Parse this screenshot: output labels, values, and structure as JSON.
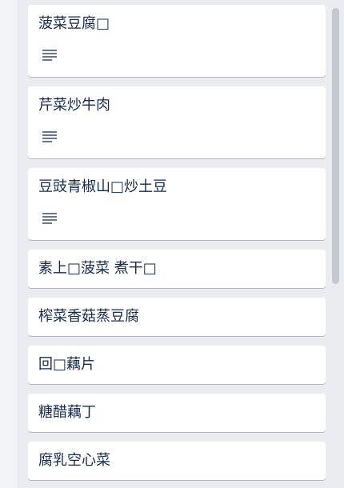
{
  "board": {
    "cards": [
      {
        "title": "菠菜豆腐□",
        "has_description": true
      },
      {
        "title": "芹菜炒牛肉",
        "has_description": true
      },
      {
        "title": "豆豉青椒山□炒土豆",
        "has_description": true
      },
      {
        "title": "素上□菠菜 煮干□",
        "has_description": false
      },
      {
        "title": "榨菜香菇蒸豆腐",
        "has_description": false
      },
      {
        "title": "回□藕片",
        "has_description": false
      },
      {
        "title": "糖醋藕丁",
        "has_description": false
      },
      {
        "title": "腐乳空心菜",
        "has_description": false
      }
    ]
  },
  "icons": {
    "description": "description-lines-icon"
  },
  "colors": {
    "card_bg": "#ffffff",
    "list_bg": "#ebecf0",
    "text": "#172b4d",
    "icon": "#6b778c",
    "scrollbar": "#c4c8cf"
  }
}
